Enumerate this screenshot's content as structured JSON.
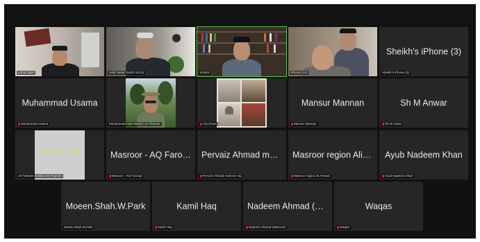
{
  "tiles_row1": [
    {
      "name": "",
      "caption": "Azhar Iqbal",
      "video": true,
      "muted": false
    },
    {
      "name": "",
      "caption": "Hafiz Mahir (kashf mirza)",
      "video": true,
      "muted": false
    },
    {
      "name": "",
      "caption": "M Butt",
      "video": true,
      "muted": false
    },
    {
      "name": "",
      "caption": "iPhone (33)",
      "video": true,
      "muted": false
    },
    {
      "name": "Sheikh's iPhone (3)",
      "caption": "Sheikh's iPhone (3)",
      "video": false,
      "muted": false
    }
  ],
  "tiles_row2": [
    {
      "name": "Muhammad Usama",
      "caption": "Muhammad Usama",
      "video": false,
      "muted": true
    },
    {
      "name": "",
      "caption": "Muhammad Iqbal Walton on Thames",
      "video": true,
      "muted": false
    },
    {
      "name": "",
      "caption": "Atiq Khan",
      "video": true,
      "muted": true
    },
    {
      "name": "Mansur Mannan",
      "caption": "Mansur Mannan",
      "video": false,
      "muted": true
    },
    {
      "name": "Sh M Anwar",
      "caption": "Sh M Anwar",
      "video": false,
      "muted": true
    }
  ],
  "tiles_row3": [
    {
      "name": "Ali Faheem",
      "caption": "Ali Faheem Walton On Thames",
      "video": true,
      "muted": false
    },
    {
      "name": "Masroor - AQ Farooqi",
      "caption": "Masroor - AQ Farooqi",
      "video": false,
      "muted": true
    },
    {
      "name": "Pervaiz Ahmad  masr...",
      "caption": "Pervaiz Ahmad  masroor reg",
      "video": false,
      "muted": true
    },
    {
      "name": "Masroor region Ali Ah...",
      "caption": "Masroor region Ali Ahmad",
      "video": false,
      "muted": true
    },
    {
      "name": "Ayub Nadeem Khan",
      "caption": "Ayub Nadeem Khan",
      "video": false,
      "muted": true
    }
  ],
  "tiles_row4": [
    {
      "name": "Moeen.Shah.W.Park",
      "caption": "Moeen.Shah.W.Park",
      "video": false,
      "muted": false
    },
    {
      "name": "Kamil Haq",
      "caption": "Kamil Haq",
      "video": false,
      "muted": true
    },
    {
      "name": "Nadeem  Ahmad (Ma...",
      "caption": "Nadeem  Ahmad (Masroor)",
      "video": false,
      "muted": true
    },
    {
      "name": "Waqas",
      "caption": "Waqas",
      "video": false,
      "muted": true
    }
  ],
  "colors": {
    "tile_bg": "#262626",
    "frame_bg": "#111111",
    "mute_red": "#e02020",
    "ali_faheem_text": "#e4d95a"
  }
}
